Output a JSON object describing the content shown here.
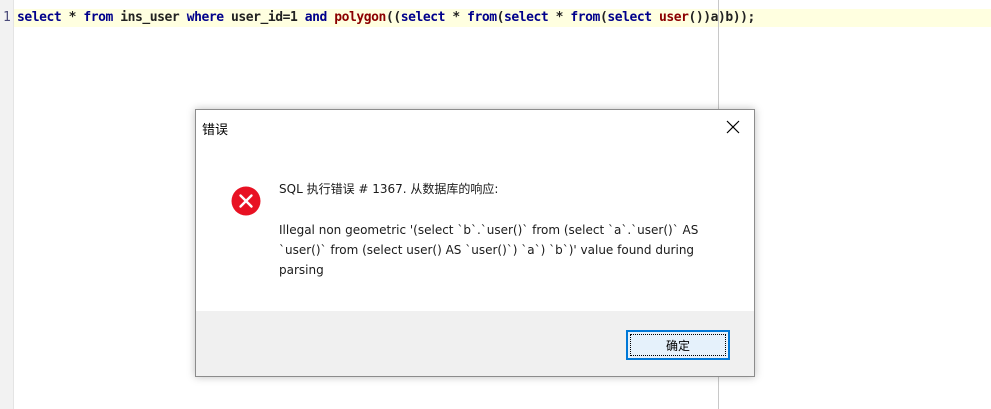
{
  "editor": {
    "line_number": "1",
    "code_tokens": [
      {
        "t": "select",
        "c": "kw"
      },
      {
        "t": " * ",
        "c": "text"
      },
      {
        "t": "from",
        "c": "kw"
      },
      {
        "t": " ins_user ",
        "c": "text"
      },
      {
        "t": "where",
        "c": "kw"
      },
      {
        "t": " user_id=",
        "c": "text"
      },
      {
        "t": "1",
        "c": "num"
      },
      {
        "t": " ",
        "c": "text"
      },
      {
        "t": "and",
        "c": "kw"
      },
      {
        "t": " ",
        "c": "text"
      },
      {
        "t": "polygon",
        "c": "fn"
      },
      {
        "t": "((",
        "c": "text"
      },
      {
        "t": "select",
        "c": "kw"
      },
      {
        "t": " * ",
        "c": "text"
      },
      {
        "t": "from",
        "c": "kw"
      },
      {
        "t": "(",
        "c": "text"
      },
      {
        "t": "select",
        "c": "kw"
      },
      {
        "t": " * ",
        "c": "text"
      },
      {
        "t": "from",
        "c": "kw"
      },
      {
        "t": "(",
        "c": "text"
      },
      {
        "t": "select",
        "c": "kw"
      },
      {
        "t": " ",
        "c": "text"
      },
      {
        "t": "user",
        "c": "fn"
      },
      {
        "t": "())a)b));",
        "c": "text"
      }
    ],
    "colors": {
      "keyword": "#00008b",
      "function": "#8b0000",
      "current_line": "#ffffe0"
    }
  },
  "dialog": {
    "title": "错误",
    "icon": "error-x-icon",
    "header": "SQL 执行错误 # 1367. 从数据库的响应:",
    "detail": "Illegal non geometric '(select `b`.`user()` from (select `a`.`user()` AS `user()` from (select user() AS `user()`) `a`) `b`)' value found during parsing",
    "ok_label": "确定",
    "colors": {
      "error_red": "#e81123",
      "button_border": "#0078d7",
      "footer_bg": "#f0f0f0"
    }
  }
}
